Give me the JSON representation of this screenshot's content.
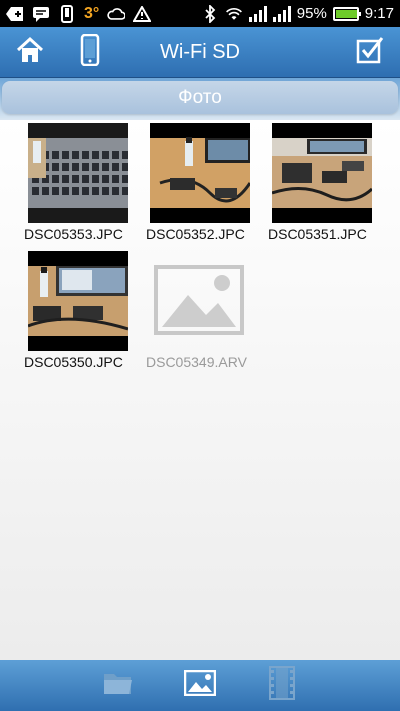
{
  "status_bar": {
    "temperature": "3°",
    "battery_percent": "95%",
    "battery_level": 0.95,
    "time": "9:17",
    "icons": [
      "add-icon",
      "chat-icon",
      "phone-icon",
      "cloud-icon",
      "warning-icon",
      "bluetooth-icon",
      "wifi-icon",
      "signal-icon",
      "signal-icon",
      "battery-charging-icon"
    ]
  },
  "header": {
    "title": "Wi-Fi SD",
    "left_icons": [
      "home-icon",
      "device-icon"
    ],
    "right_icon": "checkbox-icon"
  },
  "section": {
    "title": "Фото"
  },
  "photos": [
    {
      "filename": "DSC05353.JPG",
      "label": "DSC05353.JPC",
      "kind": "photo",
      "scene": "keyboard"
    },
    {
      "filename": "DSC05352.JPG",
      "label": "DSC05352.JPC",
      "kind": "photo",
      "scene": "desk"
    },
    {
      "filename": "DSC05351.JPG",
      "label": "DSC05351.JPC",
      "kind": "photo",
      "scene": "desk-wide"
    },
    {
      "filename": "DSC05350.JPG",
      "label": "DSC05350.JPC",
      "kind": "photo",
      "scene": "monitor"
    },
    {
      "filename": "DSC05349.ARW",
      "label": "DSC05349.ARV",
      "kind": "placeholder",
      "scene": "none"
    }
  ],
  "bottom_bar": {
    "tabs": [
      {
        "name": "folder-tab",
        "icon": "folder-icon",
        "active": false
      },
      {
        "name": "photo-tab",
        "icon": "image-icon",
        "active": true
      },
      {
        "name": "video-tab",
        "icon": "film-icon",
        "active": false
      }
    ]
  },
  "colors": {
    "header_blue": "#3a82c4",
    "section_blue": "#b7cce3",
    "battery_green": "#6ecb2a",
    "temperature_orange": "#f5a623"
  }
}
